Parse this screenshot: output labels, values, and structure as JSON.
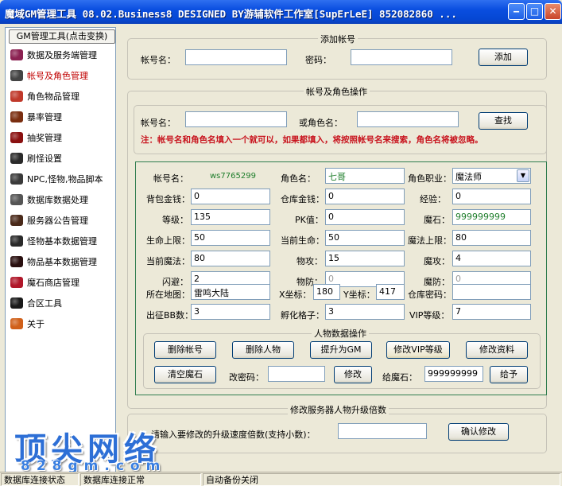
{
  "window": {
    "title": "魔域GM管理工具 08.02.Business8 DESIGNED BY游辅软件工作室[SupErLeE] 852082860 ..."
  },
  "sidebar": {
    "header_button": "GM管理工具(点击变换)",
    "items": [
      {
        "label": "数据及服务端管理",
        "icon": "book-icon",
        "color": "#8b2252"
      },
      {
        "label": "帐号及角色管理",
        "icon": "person-icon",
        "color": "#444444"
      },
      {
        "label": "角色物品管理",
        "icon": "pepper-icon",
        "color": "#c0392b"
      },
      {
        "label": "暴率管理",
        "icon": "horn-icon",
        "color": "#7a2e10"
      },
      {
        "label": "抽奖管理",
        "icon": "fire-icon",
        "color": "#8a1010"
      },
      {
        "label": "刷怪设置",
        "icon": "flag-icon",
        "color": "#2a2a2a"
      },
      {
        "label": "NPC,怪物,物品脚本",
        "icon": "figure-icon",
        "color": "#3a3a3a"
      },
      {
        "label": "数据库数据处理",
        "icon": "ring-icon",
        "color": "#555555"
      },
      {
        "label": "服务器公告管理",
        "icon": "book-dark-icon",
        "color": "#4a2a1a"
      },
      {
        "label": "怪物基本数据管理",
        "icon": "spider-icon",
        "color": "#2a2a2a"
      },
      {
        "label": "物品基本数据管理",
        "icon": "bug-icon",
        "color": "#2a1010"
      },
      {
        "label": "魔石商店管理",
        "icon": "hat-icon",
        "color": "#b0172a"
      },
      {
        "label": "合区工具",
        "icon": "ball-icon",
        "color": "#1a1a1a"
      },
      {
        "label": "关于",
        "icon": "fairy-icon",
        "color": "#d0601a"
      }
    ]
  },
  "add_account": {
    "title": "添加帐号",
    "account_label": "帐号名：",
    "account_value": "",
    "password_label": "密码：",
    "password_value": "",
    "add_button": "添加"
  },
  "ops": {
    "title": "帐号及角色操作",
    "account_label": "帐号名：",
    "account_value": "",
    "or_role_label": "或角色名：",
    "role_value": "",
    "search_button": "查找",
    "notice": "注：帐号名和角色名填入一个就可以，如果都填入，将按照帐号名来搜索，角色名将被忽略。"
  },
  "character": {
    "account_label": "帐号名：",
    "account_value": "ws7765299",
    "role_label": "角色名：",
    "role_value": "七哥",
    "class_label": "角色职业：",
    "class_value": "魔法师",
    "bag_gold_label": "背包金钱：",
    "bag_gold": "0",
    "storage_gold_label": "仓库金钱：",
    "storage_gold": "0",
    "exp_label": "经验：",
    "exp": "0",
    "level_label": "等级：",
    "level": "135",
    "pk_label": "PK值：",
    "pk": "0",
    "magic_stone_label": "魔石：",
    "magic_stone": "999999999",
    "hp_max_label": "生命上限：",
    "hp_max": "50",
    "hp_cur_label": "当前生命：",
    "hp_cur": "50",
    "mp_max_label": "魔法上限：",
    "mp_max": "80",
    "mp_cur_label": "当前魔法：",
    "mp_cur": "80",
    "phys_atk_label": "物攻：",
    "phys_atk": "15",
    "mag_atk_label": "魔攻：",
    "mag_atk": "4",
    "dodge_label": "闪避：",
    "dodge": "2",
    "phys_def_label": "物防：",
    "phys_def": "0",
    "mag_def_label": "魔防：",
    "mag_def": "0",
    "map_label": "所在地图：",
    "map": "雷鸣大陆",
    "x_label": "X坐标：",
    "x": "180",
    "y_label": "Y坐标：",
    "y": "417",
    "storage_pwd_label": "仓库密码：",
    "storage_pwd": "",
    "bb_label": "出征BB数：",
    "bb": "3",
    "hatch_label": "孵化格子：",
    "hatch": "3",
    "vip_label": "VIP等级：",
    "vip": "7"
  },
  "char_ops": {
    "title": "人物数据操作",
    "delete_account": "删除帐号",
    "delete_char": "删除人物",
    "promote_gm": "提升为GM",
    "edit_vip": "修改VIP等级",
    "edit_info": "修改资料",
    "clear_stone": "清空魔石",
    "change_pwd_label": "改密码：",
    "change_pwd_value": "",
    "change_button": "修改",
    "give_stone_label": "给魔石：",
    "give_stone_value": "999999999",
    "give_button": "给予"
  },
  "levelup": {
    "title": "修改服务器人物升级倍数",
    "prompt": "请输入要修改的升级速度倍数(支持小数)：",
    "value": "",
    "confirm_button": "确认修改"
  },
  "watermark": {
    "main": "顶尖网络",
    "sub": "828gm.com"
  },
  "statusbar": {
    "cell1": "数据库连接状态",
    "cell2": "数据库连接正常",
    "cell3": "自动备份关闭"
  }
}
